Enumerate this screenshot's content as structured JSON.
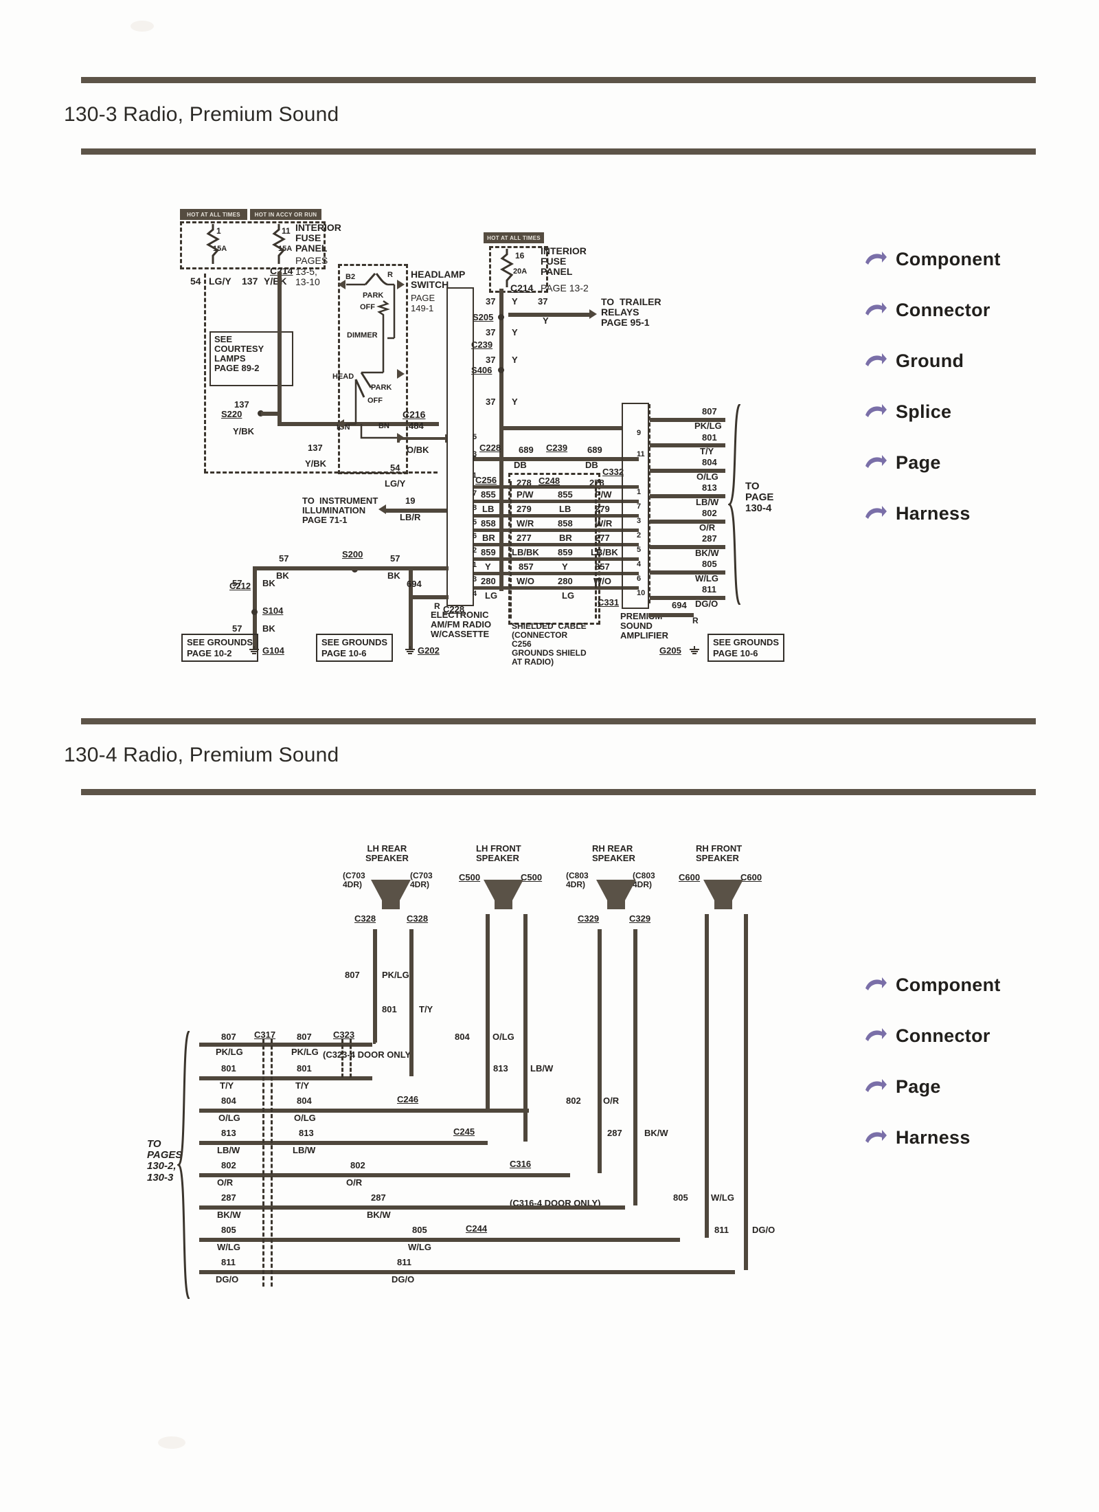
{
  "document": {
    "sections": [
      {
        "id": "130-3",
        "title": "130-3 Radio, Premium Sound"
      },
      {
        "id": "130-4",
        "title": "130-4 Radio, Premium Sound"
      }
    ]
  },
  "legend_top": {
    "items": [
      {
        "label": "Component",
        "icon": "arrow-pointer-icon"
      },
      {
        "label": "Connector",
        "icon": "arrow-pointer-icon"
      },
      {
        "label": "Ground",
        "icon": "arrow-pointer-icon"
      },
      {
        "label": "Splice",
        "icon": "arrow-pointer-icon"
      },
      {
        "label": "Page",
        "icon": "arrow-pointer-icon"
      },
      {
        "label": "Harness",
        "icon": "arrow-pointer-icon"
      }
    ],
    "accent": "#7a6fa8"
  },
  "legend_bottom": {
    "items": [
      {
        "label": "Component",
        "icon": "arrow-pointer-icon"
      },
      {
        "label": "Connector",
        "icon": "arrow-pointer-icon"
      },
      {
        "label": "Page",
        "icon": "arrow-pointer-icon"
      },
      {
        "label": "Harness",
        "icon": "arrow-pointer-icon"
      }
    ],
    "accent": "#7a6fa8"
  },
  "diagram_130_3": {
    "fuse_panel_left": {
      "hot_bars": [
        "HOT AT ALL TIMES",
        "HOT IN ACCY OR RUN"
      ],
      "fuses": [
        {
          "number": "1",
          "rating": "15A"
        },
        {
          "number": "11",
          "rating": "15A"
        }
      ],
      "connector": "C214",
      "title": "INTERIOR\nFUSE\nPANEL",
      "pages": "PAGES\n13-5,\n13-10"
    },
    "fuse_panel_right": {
      "hot_bar": "HOT AT ALL TIMES",
      "fuse": {
        "number": "16",
        "rating": "20A"
      },
      "connector": "C214",
      "title": "INTERIOR\nFUSE\nPANEL",
      "page": "PAGE 13-2"
    },
    "headlamp_switch": {
      "title": "HEADLAMP\nSWITCH",
      "page": "PAGE\n149-1",
      "terminals": [
        "B2",
        "R"
      ],
      "positions": [
        "PARK",
        "OFF",
        "HEAD",
        "IGN",
        "BN"
      ],
      "dimmer": "DIMMER"
    },
    "trailer_relays": {
      "label": "TO  TRAILER\nRELAYS\nPAGE 95-1",
      "circuit": "37",
      "color": "Y"
    },
    "courtesy_lamps": {
      "label": "SEE\nCOURTESY\nLAMPS\nPAGE 89-2"
    },
    "instrument_illumination": {
      "label": "TO  INSTRUMENT\nILLUMINATION\nPAGE 71-1",
      "circuit": "19",
      "color": "LB/R"
    },
    "left_circuits": [
      {
        "circuit": "54",
        "color": "LG/Y"
      },
      {
        "circuit": "137",
        "color": "Y/BK"
      },
      {
        "circuit": "137",
        "color": "Y/BK"
      },
      {
        "circuit": "137",
        "color": "Y/BK"
      },
      {
        "circuit": "54",
        "color": "LG/Y"
      }
    ],
    "splices": [
      "S220",
      "S205",
      "S406",
      "S200",
      "S104"
    ],
    "connectors": [
      "C214",
      "C216",
      "C212",
      "C228",
      "C239",
      "C332",
      "C256",
      "C248",
      "C331"
    ],
    "c216": {
      "name": "C216",
      "circuit": "484",
      "color": "O/BK"
    },
    "right_circuits": [
      {
        "circuit": "37",
        "color": "Y"
      },
      {
        "circuit": "37",
        "color": "Y"
      },
      {
        "circuit": "37",
        "color": "Y"
      },
      {
        "circuit": "37",
        "color": "Y"
      }
    ],
    "radio": {
      "label": "ELECTRONIC\nAM/FM RADIO\nW/CASSETTE",
      "pins_left": [
        "5",
        "3",
        "6",
        "1",
        "7",
        "8",
        "5",
        "6",
        "2",
        "1",
        "3",
        "4"
      ],
      "pins_right_top": [
        "6"
      ],
      "pins_right": [
        "9",
        "11",
        "1",
        "7",
        "3",
        "2",
        "5",
        "4",
        "6",
        "10"
      ]
    },
    "amplifier": {
      "label": "PREMIUM\nSOUND\nAMPLIFIER"
    },
    "shielded_cable": {
      "label": "SHIELDED  CABLE\n(CONNECTOR\nC256\nGROUNDS SHIELD\nAT RADIO)"
    },
    "db_bus": {
      "left_connector": "C228",
      "right_connector": "C239",
      "circuit_left": "689",
      "circuit_right": "689",
      "color_left": "DB",
      "color_right": "DB",
      "far_connector": "C332"
    },
    "shield_pair": {
      "left_connector": "C256",
      "mid_connector": "C248",
      "circuit_left": "278",
      "circuit_right": "278"
    },
    "wire_table": {
      "headers": [
        "pin_l",
        "code_l",
        "color_l",
        "code_r",
        "color_r",
        "pin_r"
      ],
      "rows": [
        {
          "pin_l": "7",
          "code_l": "855",
          "color_l": "P/W",
          "code_r": "855",
          "color_r": "P/W",
          "pin_r": "1"
        },
        {
          "pin_l": "8",
          "code_l": "LB",
          "color_l": "279",
          "code_r": "LB",
          "color_r": "279",
          "pin_r": "7"
        },
        {
          "pin_l": "5",
          "code_l": "858",
          "color_l": "W/R",
          "code_r": "858",
          "color_r": "W/R",
          "pin_r": "3"
        },
        {
          "pin_l": "6",
          "code_l": "BR",
          "color_l": "277",
          "code_r": "BR",
          "color_r": "277",
          "pin_r": "2"
        },
        {
          "pin_l": "2",
          "code_l": "859",
          "color_l": "LB/BK",
          "code_r": "859",
          "color_r": "LB/BK",
          "pin_r": "5"
        },
        {
          "pin_l": "1",
          "code_l": "Y",
          "color_l": "857",
          "code_r": "Y",
          "color_r": "857",
          "pin_r": "4"
        },
        {
          "pin_l": "3",
          "code_l": "280",
          "color_l": "W/O",
          "code_r": "280",
          "color_r": "W/O",
          "pin_r": "6"
        },
        {
          "pin_l": "4",
          "code_l": "LG",
          "color_l": "",
          "code_r": "LG",
          "color_r": "",
          "pin_r": "10"
        }
      ]
    },
    "amp_outputs": {
      "page_ref": "TO\nPAGE\n130-4",
      "wires": [
        {
          "circuit": "807",
          "color": "PK/LG"
        },
        {
          "circuit": "801",
          "color": "T/Y"
        },
        {
          "circuit": "804",
          "color": "O/LG"
        },
        {
          "circuit": "813",
          "color": "LB/W"
        },
        {
          "circuit": "802",
          "color": "O/R"
        },
        {
          "circuit": "287",
          "color": "BK/W"
        },
        {
          "circuit": "805",
          "color": "W/LG"
        },
        {
          "circuit": "811",
          "color": "DG/O"
        }
      ]
    },
    "grounds": [
      {
        "box": "SEE GROUNDS\nPAGE 10-2",
        "id": "G104"
      },
      {
        "box": "SEE GROUNDS\nPAGE 10-6",
        "id": "G202"
      },
      {
        "box": "SEE GROUNDS\nPAGE 10-6",
        "id": "G205"
      }
    ],
    "ground_wires": [
      {
        "circuit": "57",
        "color": "BK"
      },
      {
        "circuit": "57",
        "color": "BK"
      },
      {
        "circuit": "57",
        "color": "BK"
      },
      {
        "circuit": "57",
        "color": "BK"
      },
      {
        "circuit": "694",
        "color": "R"
      }
    ]
  },
  "diagram_130_4": {
    "speakers": [
      {
        "name": "LH REAR\nSPEAKER",
        "conn_left": "(C703\n4DR)",
        "conn_right": "(C703\n4DR)",
        "sub_left": "C328",
        "sub_right": "C328"
      },
      {
        "name": "LH FRONT\nSPEAKER",
        "conn_left": "C500",
        "conn_right": "C500",
        "sub_left": "",
        "sub_right": ""
      },
      {
        "name": "RH REAR\nSPEAKER",
        "conn_left": "(C803\n4DR)",
        "conn_right": "(C803\n4DR)",
        "sub_left": "C329",
        "sub_right": "C329"
      },
      {
        "name": "RH FRONT\nSPEAKER",
        "conn_left": "C600",
        "conn_right": "C600",
        "sub_left": "",
        "sub_right": ""
      }
    ],
    "page_ref": "TO\nPAGES\n130-2,\n130-3",
    "connectors": [
      "C317",
      "C323",
      "C246",
      "C245",
      "C316",
      "C244"
    ],
    "notes": [
      "(C323-4 DOOR ONLY)",
      "(C316-4 DOOR ONLY)"
    ],
    "bus_wires": [
      {
        "circuit": "807",
        "color": "PK/LG",
        "circuit2": "807",
        "color2": "PK/LG"
      },
      {
        "circuit": "801",
        "color": "T/Y",
        "circuit2": "801",
        "color2": "T/Y"
      },
      {
        "circuit": "804",
        "color": "O/LG",
        "circuit2": "804",
        "color2": "O/LG"
      },
      {
        "circuit": "813",
        "color": "LB/W",
        "circuit2": "813",
        "color2": "LB/W"
      },
      {
        "circuit": "802",
        "color": "O/R",
        "circuit2": "802",
        "color2": "O/R"
      },
      {
        "circuit": "287",
        "color": "BK/W",
        "circuit2": "287",
        "color2": "BK/W"
      },
      {
        "circuit": "805",
        "color": "W/LG",
        "circuit2": "805",
        "color2": "W/LG"
      },
      {
        "circuit": "811",
        "color": "DG/O",
        "circuit2": "811",
        "color2": "DG/O"
      }
    ],
    "branch_labels": [
      {
        "circuit": "807",
        "color": "PK/LG"
      },
      {
        "circuit": "801",
        "color": "T/Y"
      },
      {
        "circuit": "804",
        "color": "O/LG"
      },
      {
        "circuit": "813",
        "color": "LB/W"
      },
      {
        "circuit": "802",
        "color": "O/R"
      },
      {
        "circuit": "287",
        "color": "BK/W"
      },
      {
        "circuit": "805",
        "color": "W/LG"
      },
      {
        "circuit": "811",
        "color": "DG/O"
      }
    ]
  }
}
